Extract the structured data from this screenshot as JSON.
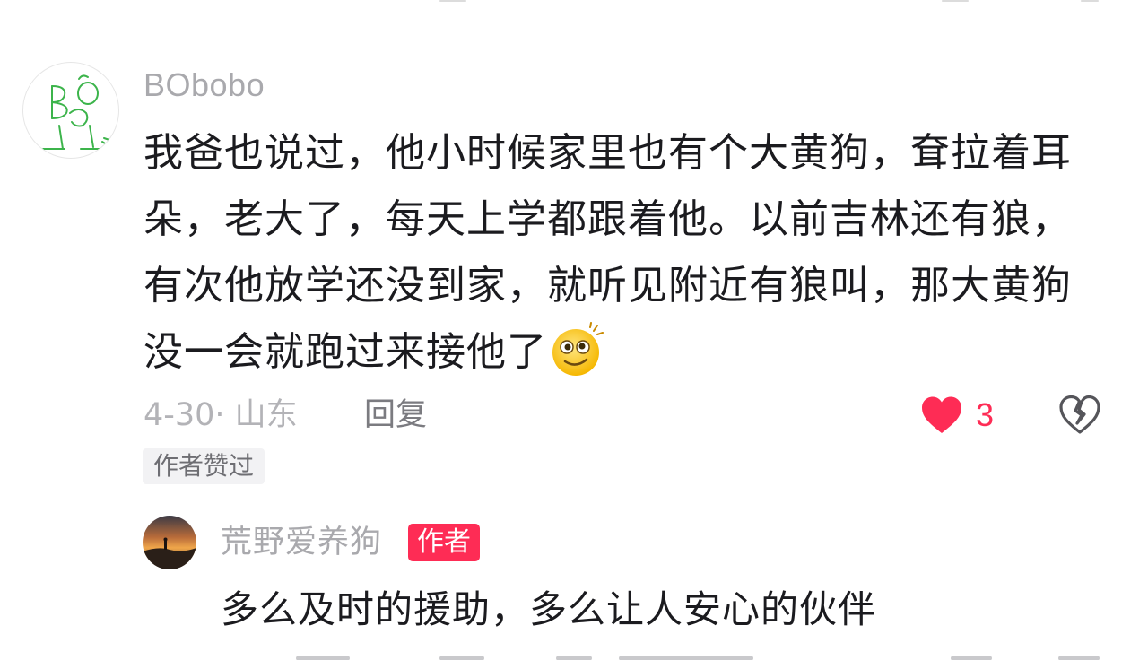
{
  "comment": {
    "username": "BObobo",
    "text": "我爸也说过，他小时候家里也有个大黄狗，耷拉着耳朵，老大了，每天上学都跟着他。以前吉林还有狼，有次他放学还没到家，就听见附近有狼叫，那大黄狗没一会就跑过来接他了",
    "emoji": "woozy-face-emoji",
    "date_location": "4-30· 山东",
    "reply_label": "回复",
    "like_count": "3",
    "liked": true,
    "author_liked_badge": "作者赞过"
  },
  "reply": {
    "username": "荒野爱养狗",
    "author_badge": "作者",
    "text": "多么及时的援助，多么让人安心的伙伴"
  },
  "colors": {
    "accent": "#fe2c55",
    "meta_gray": "#b3b3b7",
    "text": "#1b1b1f",
    "badge_bg": "#f2f2f4"
  },
  "icons": {
    "like": "heart-icon",
    "dislike": "broken-heart-icon"
  }
}
